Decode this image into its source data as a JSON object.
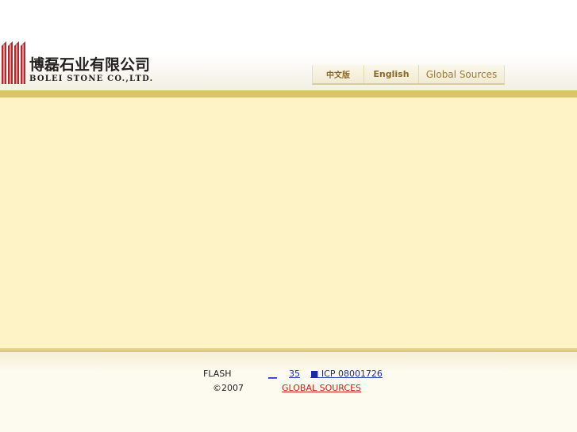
{
  "header": {
    "company_name_cn": "博磊石业有限公司",
    "company_name_en": "BOLEI STONE CO.,LTD.",
    "brand_color": "#b5282e",
    "logo_icon": "striped-pillar-logo"
  },
  "language_bar": {
    "chinese_label": "中文版",
    "english_label": "English",
    "global_sources_label": "Global Sources"
  },
  "colors": {
    "gold_band": "#d9c46a",
    "main_background": "#fdf3c7",
    "link_blue": "#1a2a9c",
    "link_red": "#c8201a"
  },
  "footer": {
    "flash_label": "FLASH",
    "link_1": "__",
    "link_2": "35",
    "icp_label": "■ ICP 08001726",
    "copyright": "©2007",
    "global_sources_link": "GLOBAL SOURCES"
  }
}
